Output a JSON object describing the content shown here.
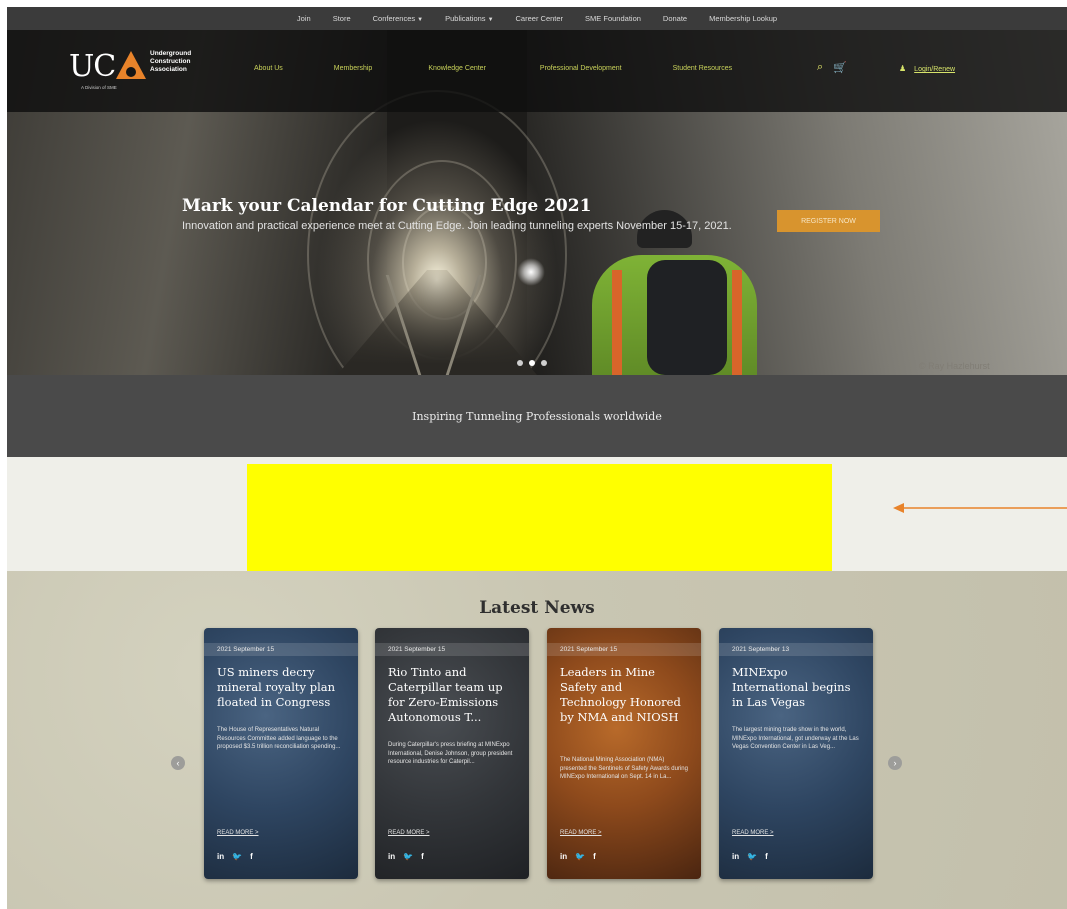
{
  "topbar": {
    "links": [
      {
        "label": "Join",
        "caret": ""
      },
      {
        "label": "Store",
        "caret": ""
      },
      {
        "label": "Conferences",
        "caret": "▼"
      },
      {
        "label": "Publications",
        "caret": "▼"
      },
      {
        "label": "Career Center",
        "caret": ""
      },
      {
        "label": "SME Foundation",
        "caret": ""
      },
      {
        "label": "Donate",
        "caret": ""
      },
      {
        "label": "Membership Lookup",
        "caret": ""
      }
    ]
  },
  "logo": {
    "letters": "UC",
    "association": "Underground Construction Association",
    "tagline": "A Division of SME"
  },
  "mainnav": {
    "items": [
      "About Us",
      "Membership",
      "Knowledge Center",
      "Professional Development",
      "Student Resources"
    ]
  },
  "login": {
    "label": "Login/Renew",
    "person_glyph": "♟"
  },
  "icons": {
    "search": "⌕",
    "cart": "🛒"
  },
  "hero": {
    "title": "Mark your Calendar for Cutting Edge 2021",
    "subtitle": "Innovation and practical experience meet at Cutting Edge. Join leading tunneling experts November 15-17, 2021.",
    "button": "REGISTER NOW",
    "credit": "© Ray Hazlehurst",
    "slides_count": 3,
    "active_slide": 2
  },
  "tagline": "Inspiring Tunneling Professionals worldwide",
  "colors": {
    "highlight": "#ffff00",
    "arrow": "#e8832a",
    "nav_accent": "#c9d25a",
    "button": "#d8942e"
  },
  "news": {
    "title": "Latest News",
    "prev_glyph": "‹",
    "next_glyph": "›",
    "read_more": "READ MORE  >",
    "social": [
      "in",
      "🐦",
      "f"
    ],
    "cards": [
      {
        "date": "2021 September 15",
        "headline": "US miners decry mineral royalty plan floated in Congress",
        "excerpt": "The House of Representatives Natural Resources Committee added language to the proposed $3.5 trillion reconciliation spending...",
        "theme": "blue"
      },
      {
        "date": "2021 September 15",
        "headline": "Rio Tinto and Caterpillar team up for Zero-Emissions Autonomous T...",
        "excerpt": "During Caterpillar's press briefing at MINExpo International, Denise Johnson, group president resource industries for Caterpil...",
        "theme": "dark"
      },
      {
        "date": "2021 September 15",
        "headline": "Leaders in Mine Safety and Technology Honored by NMA and NIOSH",
        "excerpt": "The National Mining Association (NMA) presented the Sentinels of Safety Awards during MINExpo International on Sept. 14 in La...",
        "theme": "orange"
      },
      {
        "date": "2021 September 13",
        "headline": "MINExpo International begins in Las Vegas",
        "excerpt": "The largest mining trade show in the world, MINExpo International, got underway at the Las Vegas Convention Center in Las Veg...",
        "theme": "blue"
      }
    ]
  }
}
